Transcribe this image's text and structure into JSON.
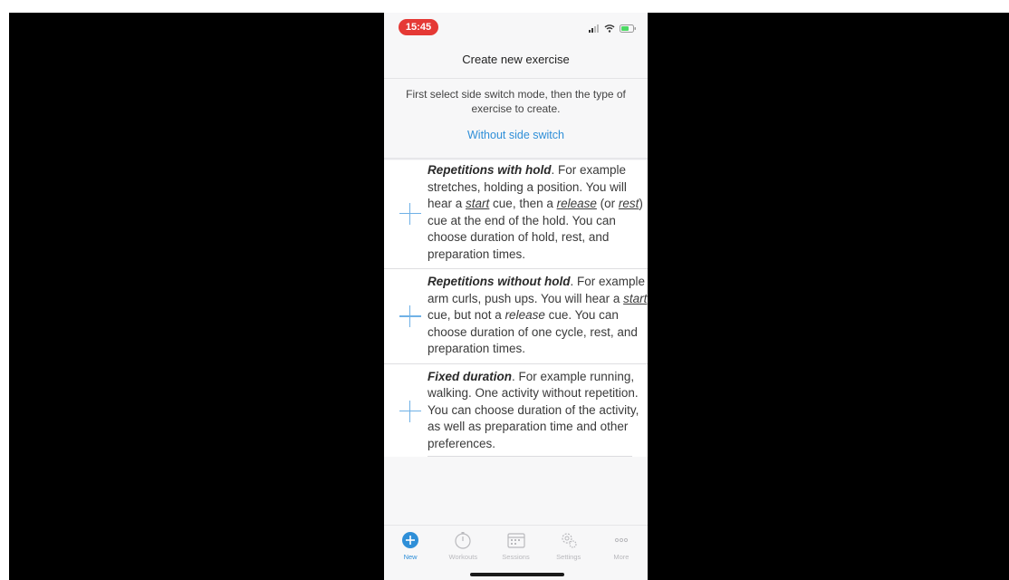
{
  "status_bar": {
    "time": "15:45",
    "icons": [
      "signal-icon",
      "wifi-icon",
      "battery-icon"
    ]
  },
  "nav": {
    "title": "Create new exercise"
  },
  "intro_text": "First select side switch mode, then the type of exercise to create.",
  "side_switch_link": "Without side switch",
  "exercise_types": [
    {
      "segments": [
        {
          "text": "Repetitions with hold",
          "style": "ttl"
        },
        {
          "text": ". For example stretches, holding a position. You will hear a ",
          "style": ""
        },
        {
          "text": "start",
          "style": "em"
        },
        {
          "text": " cue, then a ",
          "style": ""
        },
        {
          "text": "release",
          "style": "em"
        },
        {
          "text": " (or ",
          "style": ""
        },
        {
          "text": "rest",
          "style": "em"
        },
        {
          "text": ") cue at the end of the hold. You can choose duration of hold, rest, and preparation times.",
          "style": ""
        }
      ]
    },
    {
      "segments": [
        {
          "text": "Repetitions without hold",
          "style": "ttl"
        },
        {
          "text": ". For example arm curls, push ups. You will hear a ",
          "style": ""
        },
        {
          "text": "start",
          "style": "em"
        },
        {
          "text": " cue, but not a ",
          "style": ""
        },
        {
          "text": "release",
          "style": "it"
        },
        {
          "text": " cue. You can choose duration of one cycle, rest, and preparation times.",
          "style": ""
        }
      ]
    },
    {
      "segments": [
        {
          "text": "Fixed duration",
          "style": "ttl"
        },
        {
          "text": ". For example running, walking. One activity without repetition. You can choose duration of the activity, as well as preparation time and other preferences.",
          "style": ""
        }
      ]
    }
  ],
  "tabs": [
    {
      "label": "New",
      "icon": "plus-circle-icon",
      "active": true
    },
    {
      "label": "Workouts",
      "icon": "stopwatch-icon",
      "active": false
    },
    {
      "label": "Sessions",
      "icon": "calendar-icon",
      "active": false
    },
    {
      "label": "Settings",
      "icon": "gear-icon",
      "active": false
    },
    {
      "label": "More",
      "icon": "more-icon",
      "active": false
    }
  ],
  "colors": {
    "accent": "#2f8fd8",
    "time_pill": "#e53935",
    "inactive_tab": "#b9b9bd"
  }
}
